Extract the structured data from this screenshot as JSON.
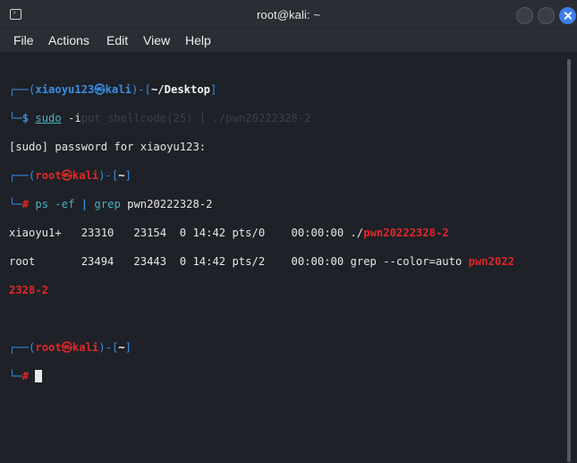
{
  "window": {
    "title": "root@kali: ~",
    "icon": "terminal-icon"
  },
  "menu": [
    "File",
    "Actions",
    "Edit",
    "View",
    "Help"
  ],
  "terminal": {
    "prompt1": {
      "corner_top": "┌──(",
      "user": "xiaoyu123",
      "at": "㉿",
      "host": "kali",
      "mid": ")-[",
      "path": "~/Desktop",
      "end": "]",
      "corner_bottom": "└─",
      "symbol": "$",
      "cmd_sudo": "sudo",
      "cmd_rest": " -i",
      "ghost": "put_shellcode(25) | ./pwn20222328-2"
    },
    "sudo_prompt": "[sudo] password for xiaoyu123:",
    "prompt2": {
      "corner_top": "┌──(",
      "user": "root",
      "at": "㉿",
      "host": "kali",
      "mid": ")-[",
      "path": "~",
      "end": "]",
      "corner_bottom": "└─",
      "symbol": "#",
      "cmd_ps": "ps",
      "cmd_args": " -ef ",
      "pipe": "|",
      "cmd_grep": " grep",
      "cmd_pattern": " pwn20222328-2"
    },
    "ps_rows": [
      {
        "prefix": "xiaoyu1+   23310   23154  0 14:42 pts/0    00:00:00 ./",
        "match": "pwn20222328-2",
        "suffix": ""
      },
      {
        "prefix": "root       23494   23443  0 14:42 pts/2    00:00:00 grep --color=auto ",
        "match": "pwn2022",
        "suffix": ""
      }
    ],
    "wrap_match": "2328-2",
    "prompt3": {
      "corner_top": "┌──(",
      "user": "root",
      "at": "㉿",
      "host": "kali",
      "mid": ")-[",
      "path": "~",
      "end": "]",
      "corner_bottom": "└─",
      "symbol": "#"
    }
  }
}
